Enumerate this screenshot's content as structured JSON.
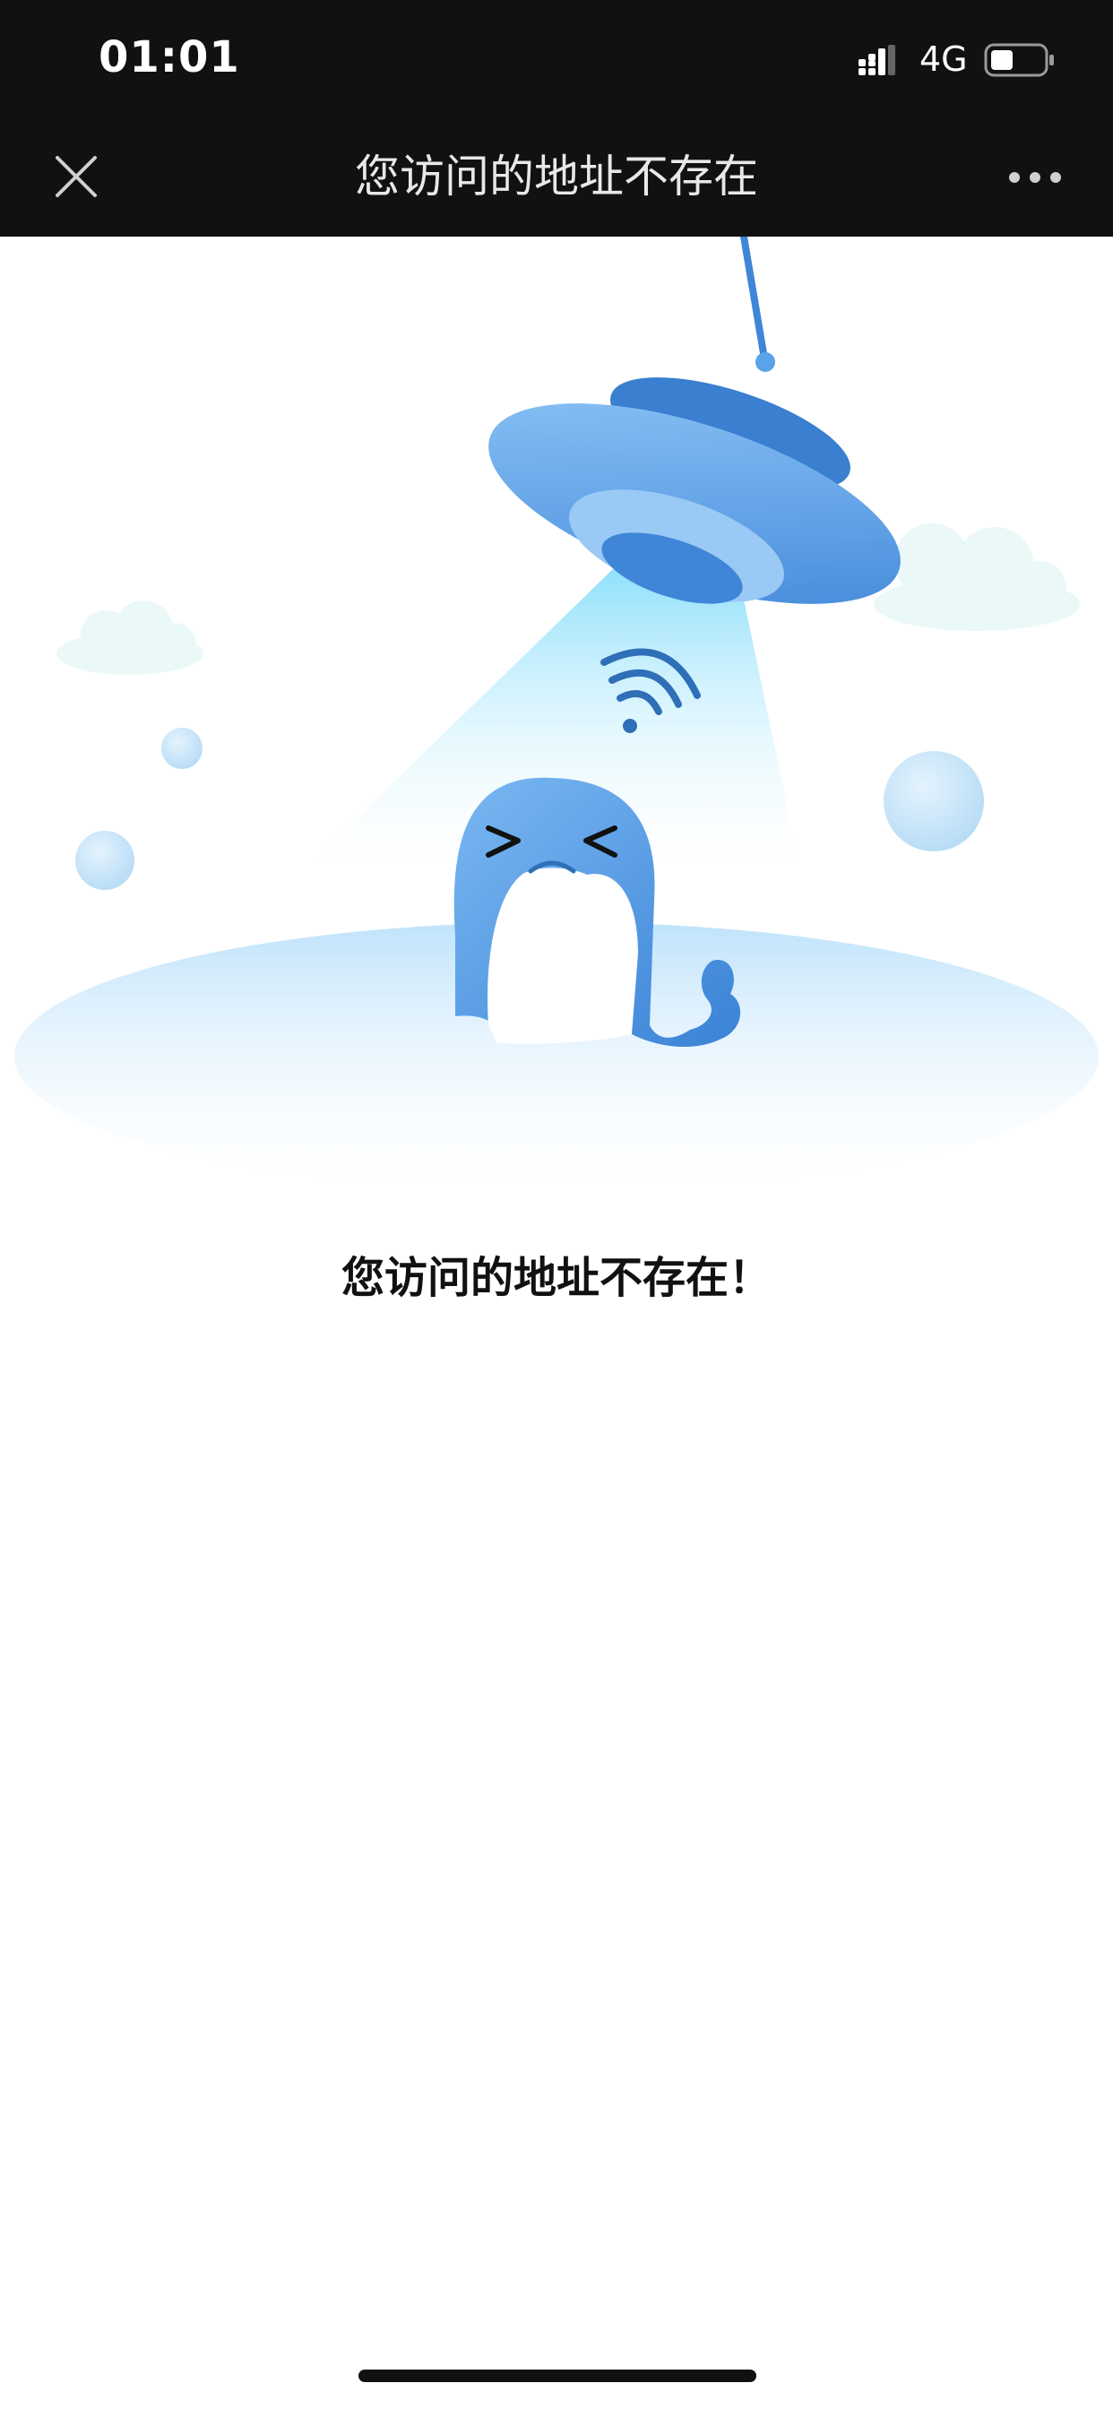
{
  "status_bar": {
    "time": "01:01",
    "network": "4G",
    "signal_icon": "cellular-signal-icon",
    "battery_icon": "battery-icon"
  },
  "nav_bar": {
    "title": "您访问的地址不存在",
    "close_icon": "close-icon",
    "more_icon": "more-dots-icon"
  },
  "illustration": {
    "description_icon": "ufo-whale-illustration"
  },
  "message": "您访问的地址不存在！",
  "colors": {
    "bar_background": "#111111",
    "accent_blue": "#4a90e2",
    "light_blue": "#bfe3fb",
    "text": "#111111"
  }
}
